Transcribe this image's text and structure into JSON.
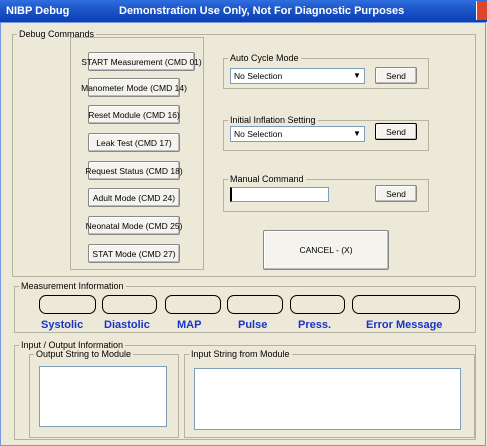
{
  "window": {
    "app_title": "NIBP Debug",
    "subtitle": "Demonstration Use Only, Not For Diagnostic Purposes"
  },
  "debug": {
    "legend": "Debug Commands",
    "commands": [
      "START Measurement  (CMD 01)",
      "Manometer Mode  (CMD 14)",
      "Reset Module  (CMD 16)",
      "Leak Test  (CMD 17)",
      "Request Status  (CMD 18)",
      "Adult Mode  (CMD 24)",
      "Neonatal Mode  (CMD 25)",
      "STAT Mode  (CMD 27)"
    ],
    "auto_cycle": {
      "legend": "Auto Cycle Mode",
      "selected": "No Selection",
      "send": "Send"
    },
    "initial_inflation": {
      "legend": "Initial Inflation Setting",
      "selected": "No Selection",
      "send": "Send"
    },
    "manual": {
      "legend": "Manual Command",
      "value": "",
      "send": "Send"
    },
    "cancel": "CANCEL - (X)"
  },
  "measurement": {
    "legend": "Measurement Information",
    "fields": [
      "Systolic",
      "Diastolic",
      "MAP",
      "Pulse",
      "Press.",
      "Error Message"
    ],
    "values": [
      "",
      "",
      "",
      "",
      "",
      ""
    ]
  },
  "io": {
    "legend": "Input / Output Information",
    "output_legend": "Output String to Module",
    "input_legend": "Input String from Module",
    "output_value": "",
    "input_value": ""
  },
  "colors": {
    "title_bar": "#0A3FB5",
    "measurement_label": "#1A33C9",
    "window_bg": "#ECE9D8"
  }
}
